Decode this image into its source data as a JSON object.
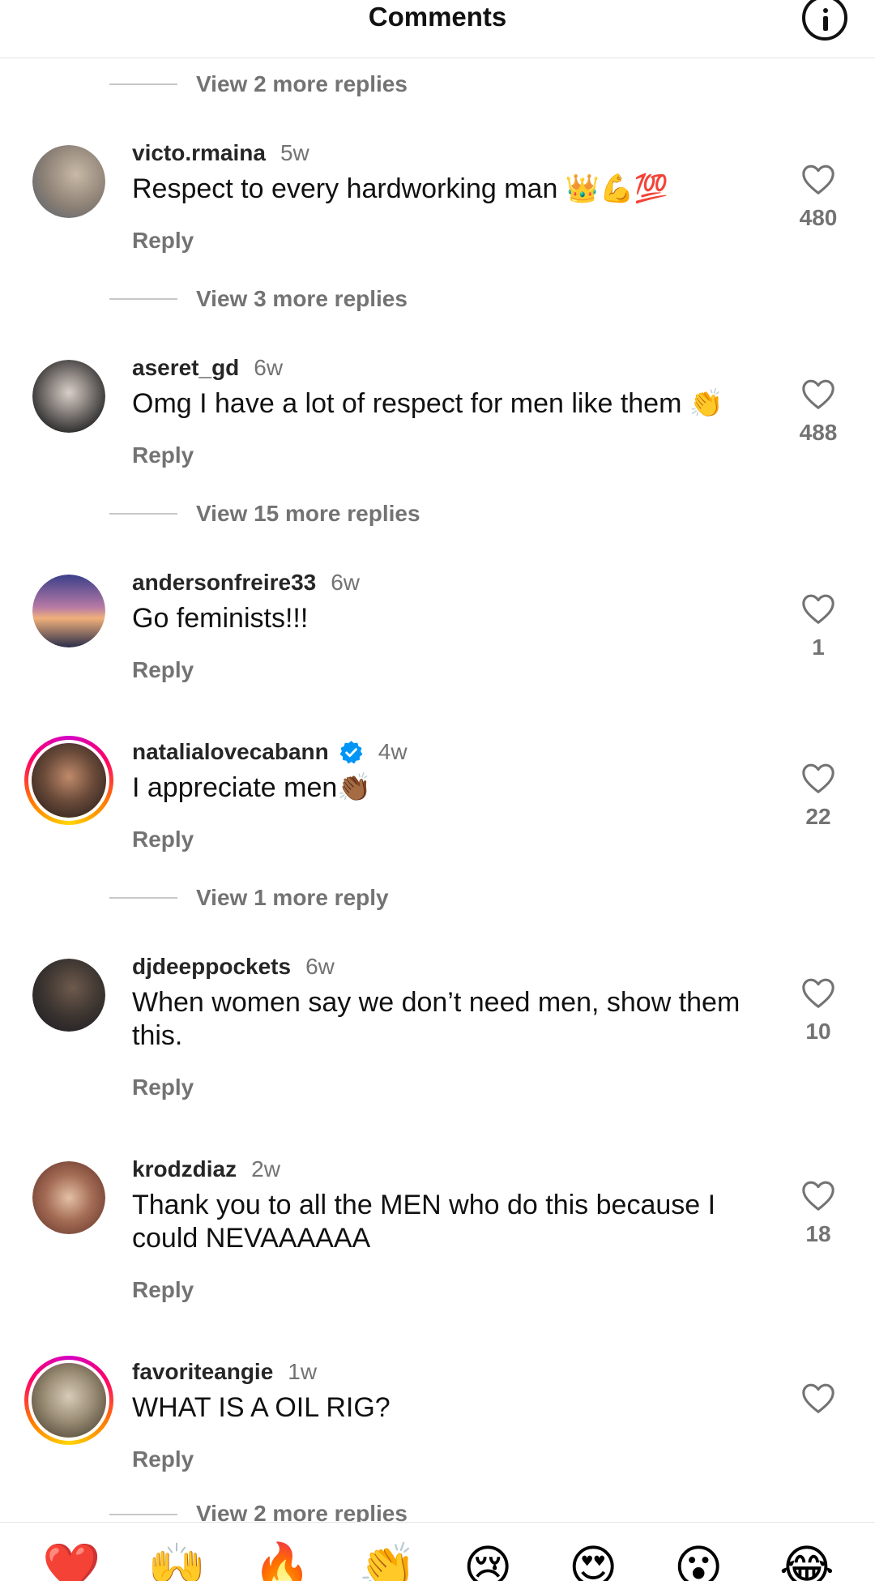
{
  "header": {
    "title": "Comments"
  },
  "view_replies_top": "View 2 more replies",
  "comments": [
    {
      "username": "victo.rmaina",
      "time": "5w",
      "text": "Respect to every hardworking man 👑💪💯",
      "reply": "Reply",
      "likes": "480",
      "avatar_color": "#8a7f74",
      "replies": "View 3 more replies"
    },
    {
      "username": "aseret_gd",
      "time": "6w",
      "text": "Omg I have a lot of respect for men like them 👏",
      "reply": "Reply",
      "likes": "488",
      "avatar_color": "#4a4a4a",
      "replies": "View 15 more replies"
    },
    {
      "username": "andersonfreire33",
      "time": "6w",
      "text": "Go feminists!!!",
      "reply": "Reply",
      "likes": "1",
      "avatar_color": "#6d5d8a"
    },
    {
      "username": "natalialovecabann",
      "time": "4w",
      "verified": true,
      "text": "I appreciate men👏🏾",
      "reply": "Reply",
      "likes": "22",
      "avatar_color": "#6b4b3a",
      "replies": "View 1 more reply"
    },
    {
      "username": "djdeeppockets",
      "time": "6w",
      "text": "When women say we don’t need men, show them this.",
      "reply": "Reply",
      "likes": "10",
      "avatar_color": "#3b3430"
    },
    {
      "username": "krodzdiaz",
      "time": "2w",
      "text": "Thank you to all the MEN who do this because I could NEVAAAAAA",
      "reply": "Reply",
      "likes": "18",
      "avatar_color": "#a46c55"
    },
    {
      "username": "favoriteangie",
      "time": "1w",
      "text": "WHAT IS A OIL RIG?",
      "reply": "Reply",
      "likes": "",
      "avatar_color": "#9a8c74",
      "replies": "View 2 more replies"
    }
  ],
  "emoji_bar": [
    "❤️",
    "🙌",
    "🔥",
    "👏",
    "😢",
    "😍",
    "😮",
    "😂"
  ]
}
